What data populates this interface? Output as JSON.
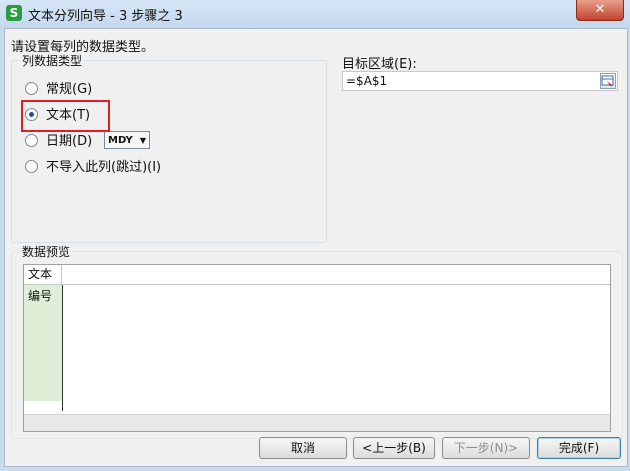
{
  "window": {
    "title": "文本分列向导 - 3 步骤之 3",
    "app_icon_letter": "S",
    "close_glyph": "✕"
  },
  "instruction": "请设置每列的数据类型。",
  "column_type": {
    "group_title": "列数据类型",
    "options": [
      {
        "label": "常规(G)",
        "checked": false
      },
      {
        "label": "文本(T)",
        "checked": true
      },
      {
        "label": "日期(D)",
        "checked": false
      },
      {
        "label": "不导入此列(跳过)(I)",
        "checked": false
      }
    ],
    "date_format": "MDY"
  },
  "destination": {
    "label": "目标区域(E):",
    "value": "=$A$1"
  },
  "preview": {
    "group_title": "数据预览",
    "column_header": "文本",
    "cells": [
      "编号"
    ]
  },
  "buttons": {
    "cancel": "取消",
    "back": "<上一步(B)",
    "next": "下一步(N)>",
    "finish": "完成(F)"
  }
}
